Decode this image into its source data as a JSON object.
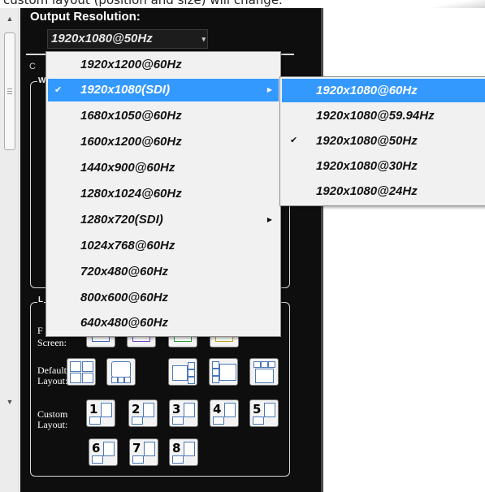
{
  "caption": "custom layout (position and size) will change.",
  "output": {
    "label": "Output Resolution:",
    "selected": "1920x1080@50Hz",
    "hidden_tab_char": "C"
  },
  "groups": {
    "window_label": "W",
    "layout_label": "L"
  },
  "rows": {
    "screen_label_1": "F",
    "screen_label_2": "Screen:",
    "default_label_1": "Default",
    "default_label_2": "Layout:",
    "custom_label_1": "Custom",
    "custom_label_2": "Layout:"
  },
  "custom_layouts": [
    "1",
    "2",
    "3",
    "4",
    "5",
    "6",
    "7",
    "8"
  ],
  "menu": {
    "items": [
      {
        "label": "1920x1200@60Hz",
        "checked": false,
        "submenu": false
      },
      {
        "label": "1920x1080(SDI)",
        "checked": true,
        "submenu": true,
        "highlighted": true
      },
      {
        "label": "1680x1050@60Hz",
        "checked": false,
        "submenu": false
      },
      {
        "label": "1600x1200@60Hz",
        "checked": false,
        "submenu": false
      },
      {
        "label": "1440x900@60Hz",
        "checked": false,
        "submenu": false
      },
      {
        "label": "1280x1024@60Hz",
        "checked": false,
        "submenu": false
      },
      {
        "label": "1280x720(SDI)",
        "checked": false,
        "submenu": true
      },
      {
        "label": "1024x768@60Hz",
        "checked": false,
        "submenu": false
      },
      {
        "label": "720x480@60Hz",
        "checked": false,
        "submenu": false
      },
      {
        "label": "800x600@60Hz",
        "checked": false,
        "submenu": false
      },
      {
        "label": "640x480@60Hz",
        "checked": false,
        "submenu": false
      }
    ]
  },
  "submenu": {
    "items": [
      {
        "label": "1920x1080@60Hz",
        "checked": false,
        "highlighted": true
      },
      {
        "label": "1920x1080@59.94Hz",
        "checked": false
      },
      {
        "label": "1920x1080@50Hz",
        "checked": true
      },
      {
        "label": "1920x1080@30Hz",
        "checked": false
      },
      {
        "label": "1920x1080@24Hz",
        "checked": false
      }
    ]
  },
  "glyphs": {
    "check": "✔",
    "submenu_arrow": "▶",
    "dropdown_arrow": "▾",
    "scroll_up": "▲",
    "scroll_down": "▼"
  },
  "colors": {
    "highlight": "#3399ff",
    "panel": "#0e0e0e",
    "menu_bg": "#f1f1f1",
    "layout_outline": "#4a78b8"
  }
}
